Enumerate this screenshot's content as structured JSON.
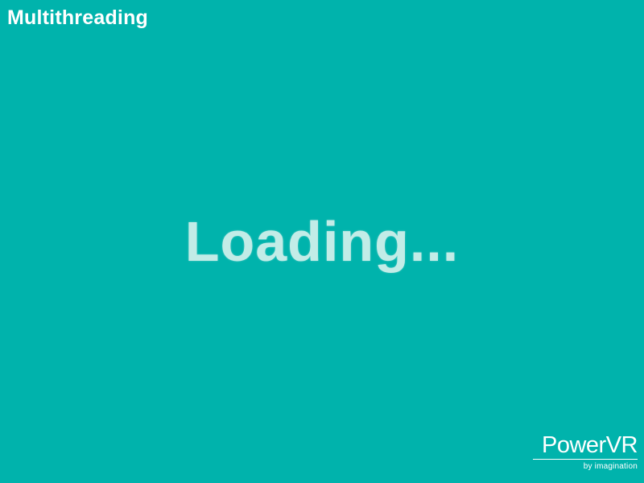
{
  "app": {
    "title": "Multithreading"
  },
  "status": {
    "message": "Loading..."
  },
  "branding": {
    "logo_text": "PowerVR",
    "tagline": "by imagination"
  },
  "colors": {
    "background": "#00b3ac",
    "loading_text": "#c2ece7",
    "title_text": "#ffffff"
  }
}
